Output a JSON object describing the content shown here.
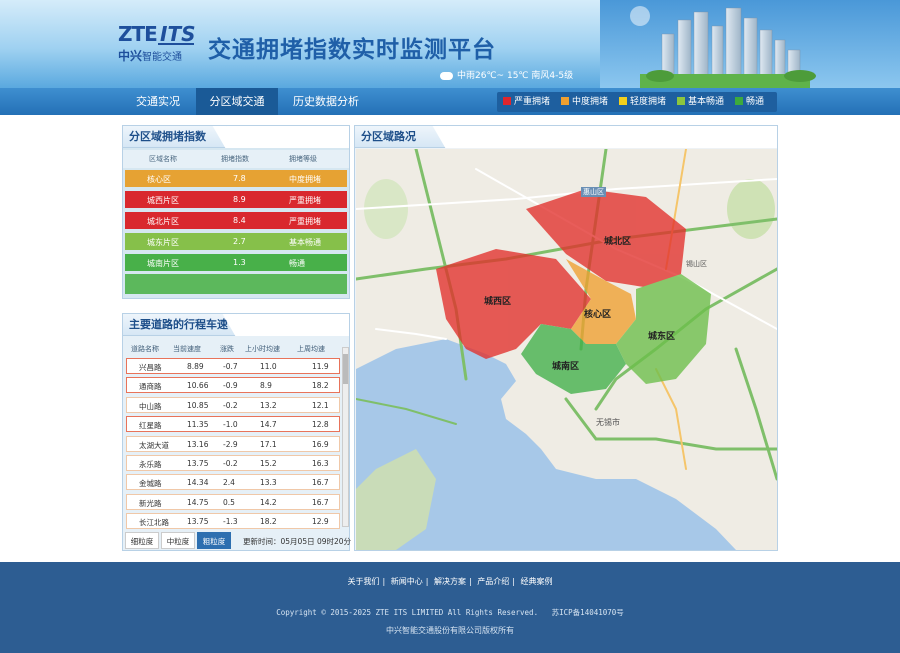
{
  "brand": {
    "logo_zte": "ZTE",
    "logo_its": "ITS",
    "logo_cn": "中兴",
    "logo_cn_sub": "智能交通"
  },
  "header": {
    "title": "交通拥堵指数实时监测平台",
    "weather": "中雨26℃~ 15℃  南风4-5级"
  },
  "nav": {
    "tabs": [
      {
        "label": "交通实况"
      },
      {
        "label": "分区域交通"
      },
      {
        "label": "历史数据分析"
      }
    ],
    "active_index": 1
  },
  "legend": [
    {
      "label": "严重拥堵",
      "color": "#e0262d"
    },
    {
      "label": "中度拥堵",
      "color": "#f0a030"
    },
    {
      "label": "轻度拥堵",
      "color": "#f3d01c"
    },
    {
      "label": "基本畅通",
      "color": "#8cc63e"
    },
    {
      "label": "畅通",
      "color": "#3daa3d"
    }
  ],
  "zone_panel": {
    "title": "分区域拥堵指数",
    "headers": [
      "区域名称",
      "拥堵指数",
      "拥堵等级"
    ],
    "rows": [
      {
        "name": "核心区",
        "index": "7.8",
        "level": "中度拥堵",
        "color": "#e6a233"
      },
      {
        "name": "城西片区",
        "index": "8.9",
        "level": "严重拥堵",
        "color": "#d9282e"
      },
      {
        "name": "城北片区",
        "index": "8.4",
        "level": "严重拥堵",
        "color": "#d9282e"
      },
      {
        "name": "城东片区",
        "index": "2.7",
        "level": "基本畅通",
        "color": "#86c04a"
      },
      {
        "name": "城南片区",
        "index": "1.3",
        "level": "畅通",
        "color": "#48b049"
      }
    ]
  },
  "road_panel": {
    "title": "主要道路的行程车速",
    "headers": [
      "道路名称",
      "当前速度",
      "涨跌",
      "上小时均速",
      "上周均速"
    ],
    "rows": [
      {
        "name": "兴昌路",
        "speed": "8.89",
        "change": "-0.7",
        "last_hour": "11.0",
        "last_week": "11.9",
        "highlight": true
      },
      {
        "name": "通商路",
        "speed": "10.66",
        "change": "-0.9",
        "last_hour": "8.9",
        "last_week": "18.2",
        "highlight": true
      },
      {
        "name": "中山路",
        "speed": "10.85",
        "change": "-0.2",
        "last_hour": "13.2",
        "last_week": "12.1",
        "highlight": false
      },
      {
        "name": "红星路",
        "speed": "11.35",
        "change": "-1.0",
        "last_hour": "14.7",
        "last_week": "12.8",
        "highlight": true
      },
      {
        "name": "太湖大道",
        "speed": "13.16",
        "change": "-2.9",
        "last_hour": "17.1",
        "last_week": "16.9",
        "highlight": false
      },
      {
        "name": "永乐路",
        "speed": "13.75",
        "change": "-0.2",
        "last_hour": "15.2",
        "last_week": "16.3",
        "highlight": false
      },
      {
        "name": "金城路",
        "speed": "14.34",
        "change": "2.4",
        "last_hour": "13.3",
        "last_week": "16.7",
        "highlight": false
      },
      {
        "name": "新光路",
        "speed": "14.75",
        "change": "0.5",
        "last_hour": "14.2",
        "last_week": "16.7",
        "highlight": false
      },
      {
        "name": "长江北路",
        "speed": "13.75",
        "change": "-1.3",
        "last_hour": "18.2",
        "last_week": "12.9",
        "highlight": false
      }
    ],
    "granularity": [
      {
        "label": "细粒度"
      },
      {
        "label": "中粒度"
      },
      {
        "label": "粗粒度"
      }
    ],
    "granularity_active": 2,
    "updated": "更新时间：05月05日 09时20分"
  },
  "map_panel": {
    "title": "分区域路况",
    "zones": [
      {
        "label": "城西区"
      },
      {
        "label": "城北区"
      },
      {
        "label": "核心区"
      },
      {
        "label": "城东区"
      },
      {
        "label": "城南区"
      }
    ],
    "place_labels": [
      {
        "text": "无锡市"
      },
      {
        "text": "惠山区"
      },
      {
        "text": "锡山区"
      }
    ]
  },
  "footer": {
    "links": [
      "关于我们",
      "新闻中心",
      "解决方案",
      "产品介绍",
      "经典案例"
    ],
    "copyright": "Copyright © 2015-2025 ZTE ITS LIMITED All Rights Reserved.",
    "icp": "苏ICP备14041070号",
    "owner": "中兴智能交通股份有限公司版权所有"
  }
}
